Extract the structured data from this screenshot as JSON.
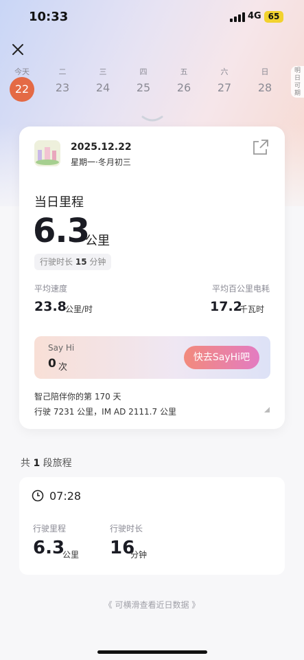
{
  "status": {
    "time": "10:33",
    "network": "4G",
    "battery": "65"
  },
  "week": {
    "days": [
      {
        "weekday": "今天",
        "date": "22",
        "selected": true
      },
      {
        "weekday": "二",
        "date": "23"
      },
      {
        "weekday": "三",
        "date": "24"
      },
      {
        "weekday": "四",
        "date": "25"
      },
      {
        "weekday": "五",
        "date": "26"
      },
      {
        "weekday": "六",
        "date": "27"
      },
      {
        "weekday": "日",
        "date": "28"
      }
    ],
    "tomorrow_tab": "明日可期"
  },
  "summary": {
    "date": "2025.12.22",
    "lunar": "星期一·冬月初三",
    "title": "当日里程",
    "distance": "6.3",
    "distance_unit": "公里",
    "duration_label": "行驶时长",
    "duration_value": "15",
    "duration_unit": "分钟",
    "avg_speed_label": "平均速度",
    "avg_speed_value": "23.8",
    "avg_speed_unit": "公里/时",
    "consumption_label": "平均百公里电耗",
    "consumption_value": "17.2",
    "consumption_unit": "千瓦时",
    "sayhi": {
      "label": "Say Hi",
      "count": "0",
      "unit": "次",
      "button": "快去SayHi吧"
    },
    "companion": "智己陪伴你的第 170 天",
    "totals": "行驶 7231 公里，IM AD 2111.7 公里"
  },
  "trips": {
    "count_prefix": "共",
    "count": "1",
    "count_suffix": "段旅程",
    "items": [
      {
        "time": "07:28",
        "distance_label": "行驶里程",
        "distance": "6.3",
        "distance_unit": "公里",
        "duration_label": "行驶时长",
        "duration": "16",
        "duration_unit": "分钟"
      }
    ]
  },
  "hint": "《 可横滑查看近日数据 》",
  "colors": {
    "accent": "#e46a45",
    "button_start": "#f28a7c",
    "button_end": "#e37cc2"
  }
}
